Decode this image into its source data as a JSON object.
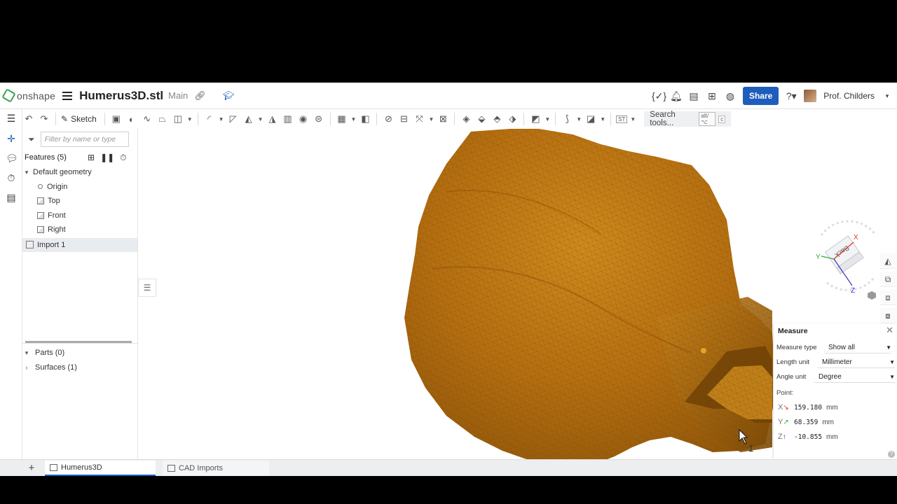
{
  "header": {
    "logo_text": "onshape",
    "document_title": "Humerus3D.stl",
    "branch": "Main",
    "share_label": "Share",
    "user_name": "Prof. Childers"
  },
  "toolbar": {
    "sketch_label": "Sketch",
    "search_label": "Search tools...",
    "search_shortcut_1": "alt/⌥",
    "search_shortcut_2": "c",
    "st_label": "ST"
  },
  "features": {
    "filter_placeholder": "Filter by name or type",
    "title": "Features (5)",
    "default_geometry": "Default geometry",
    "items": [
      "Origin",
      "Top",
      "Front",
      "Right"
    ],
    "import_item": "Import 1",
    "parts": "Parts (0)",
    "surfaces": "Surfaces (1)"
  },
  "viewcube": {
    "face_label": "Back",
    "axis_x": "X",
    "axis_y": "Y",
    "axis_z": "Z"
  },
  "measure": {
    "title": "Measure",
    "type_label": "Measure type",
    "type_value": "Show all",
    "length_label": "Length unit",
    "length_value": "Millimeter",
    "angle_label": "Angle unit",
    "angle_value": "Degree",
    "point_label": "Point:",
    "x_value": "159.180",
    "y_value": "68.359",
    "z_value": "-10.855",
    "unit": "mm"
  },
  "tabs": [
    {
      "label": "Humerus3D",
      "active": true
    },
    {
      "label": "CAD Imports",
      "active": false
    }
  ],
  "cursor_badge": "1",
  "colors": {
    "model": "#b8720f",
    "share_button": "#1f5dbd",
    "brand": "#39a34a"
  }
}
